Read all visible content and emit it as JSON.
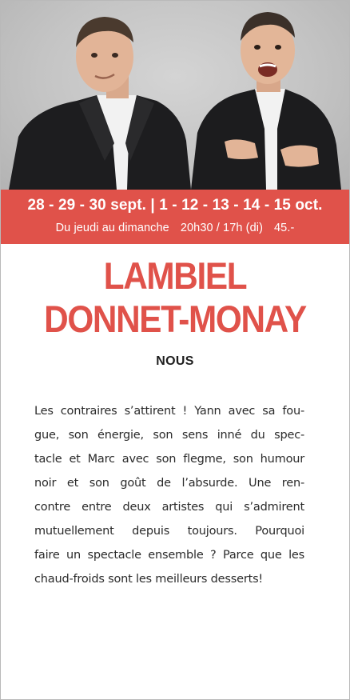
{
  "colors": {
    "accent": "#e0524a",
    "text": "#2b2b2b",
    "border": "#b9b9b9"
  },
  "banner": {
    "dates": "28 - 29 - 30 sept.  |  1 - 12 - 13 - 14 - 15 oct.",
    "days": "Du jeudi au dimanche",
    "times": "20h30 / 17h (di)",
    "price": "45.-"
  },
  "title": {
    "line1": "LAMBIEL",
    "line2": "DONNET-MONAY"
  },
  "subtitle": "NOUS",
  "description_lines": [
    "Les contraires s’attirent ! Yann avec sa fou-",
    "gue, son énergie, son sens inné du spec-",
    "tacle et Marc avec son flegme, son humour",
    "noir et son goût de l’absurde. Une ren-",
    "contre entre deux artistes qui s’admirent",
    "mutuellement depuis toujours. Pourquoi",
    "faire un spectacle ensemble ? Parce que les",
    "chaud-froids sont les meilleurs desserts!"
  ]
}
